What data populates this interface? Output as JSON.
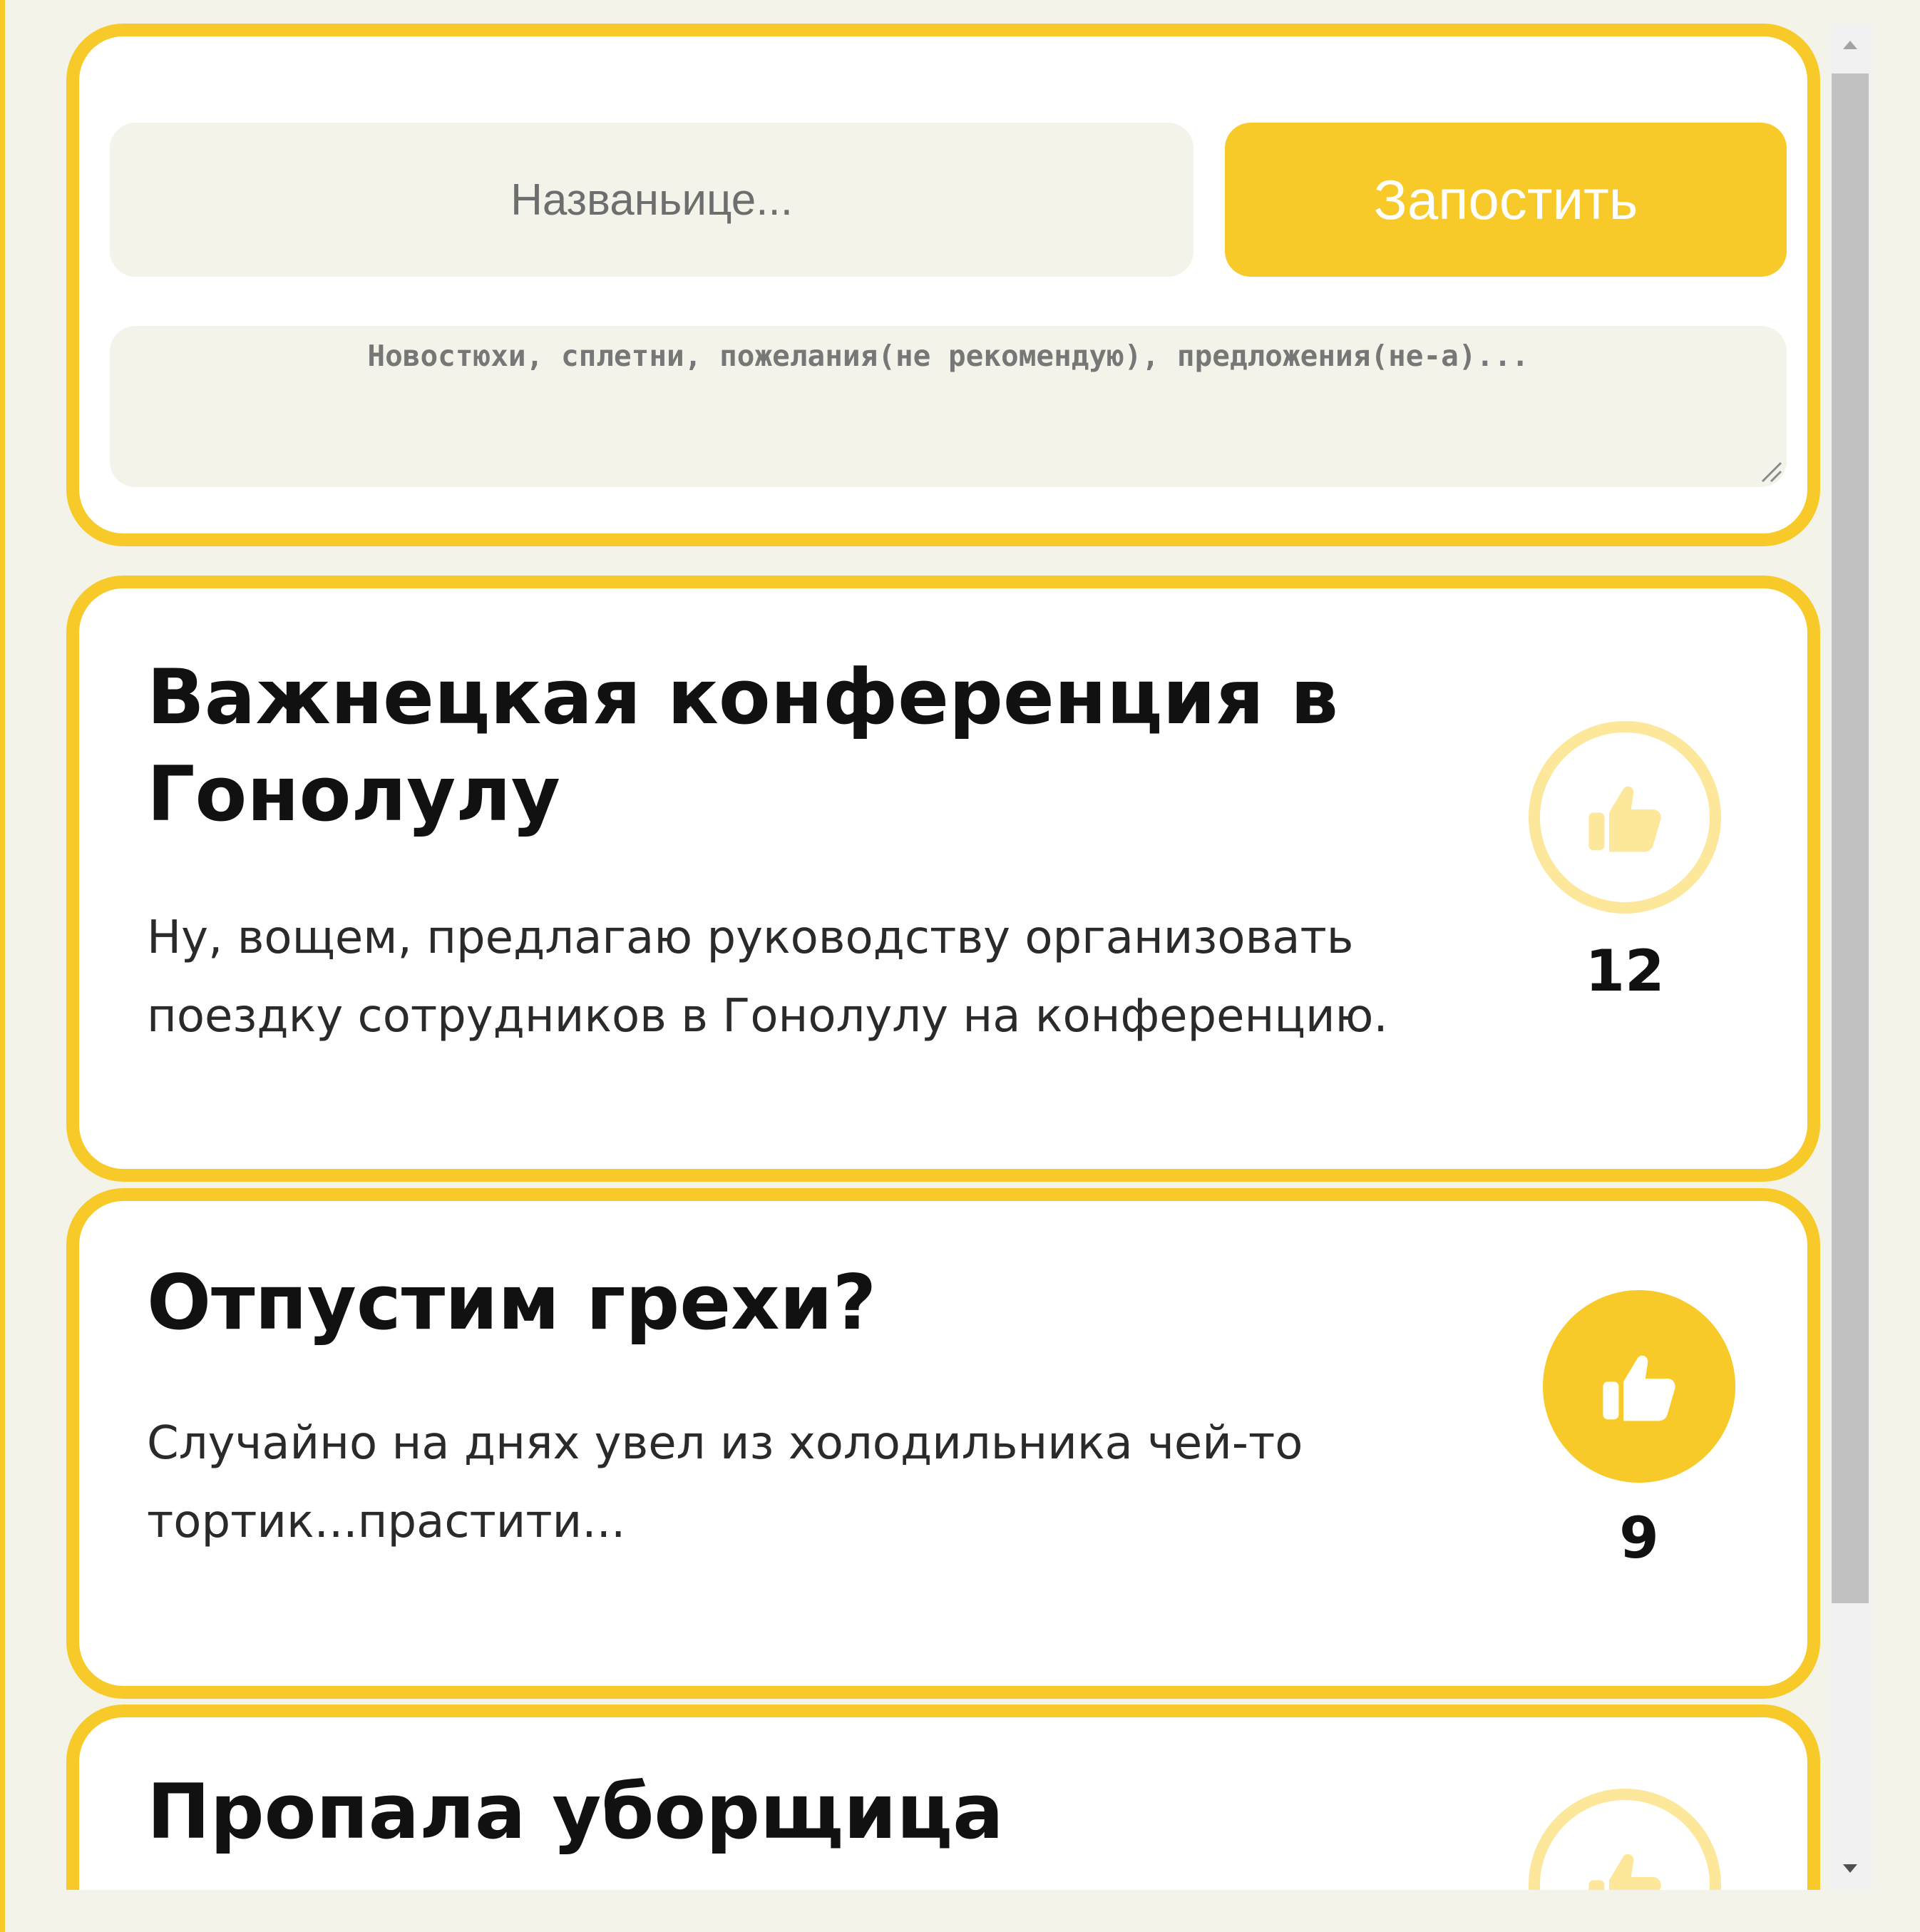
{
  "compose": {
    "title_placeholder": "Названьице...",
    "post_button_label": "Запостить",
    "body_placeholder": "Новостюхи, сплетни, пожелания(не рекомендую), предложения(не-а)..."
  },
  "posts": [
    {
      "title": "Важнецкая конференция в Гонолулу",
      "body": "Ну, вощем, предлагаю руководству организовать поездку сотрудников в Гонолулу на конференцию.",
      "likes": "12",
      "liked": false
    },
    {
      "title": "Отпустим грехи?",
      "body": "Случайно на днях увел из холодильника чей-то тортик...прастити...",
      "likes": "9",
      "liked": true
    },
    {
      "title": "Пропала уборщица",
      "liked": false
    }
  ],
  "colors": {
    "accent": "#f7ca2a",
    "accent_light": "#fde79a",
    "background": "#f4f3ea",
    "card": "#ffffff"
  },
  "icons": {
    "like": "thumbs-up-icon",
    "scroll_up": "arrow-up-icon",
    "scroll_down": "arrow-down-icon",
    "resize": "resize-grip-icon"
  }
}
